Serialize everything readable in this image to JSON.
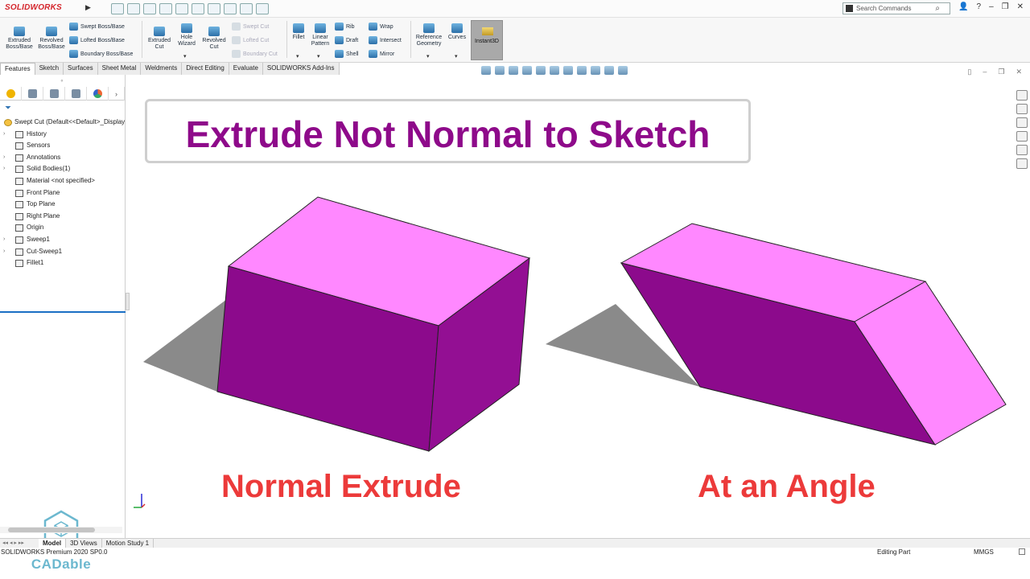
{
  "app": {
    "logo_text": "SOLIDWORKS"
  },
  "search": {
    "placeholder": "Search Commands"
  },
  "ribbon": {
    "extruded_boss": "Extruded Boss/Base",
    "revolved_boss": "Revolved Boss/Base",
    "swept_boss": "Swept Boss/Base",
    "lofted_boss": "Lofted Boss/Base",
    "boundary_boss": "Boundary Boss/Base",
    "extruded_cut": "Extruded Cut",
    "hole_wizard": "Hole Wizard",
    "revolved_cut": "Revolved Cut",
    "swept_cut": "Swept Cut",
    "lofted_cut": "Lofted Cut",
    "boundary_cut": "Boundary Cut",
    "fillet": "Fillet",
    "linear_pattern": "Linear Pattern",
    "rib": "Rib",
    "draft": "Draft",
    "shell": "Shell",
    "wrap": "Wrap",
    "intersect": "Intersect",
    "mirror": "Mirror",
    "reference_geometry": "Reference Geometry",
    "curves": "Curves",
    "instant3d": "Instant3D"
  },
  "command_tabs": [
    "Features",
    "Sketch",
    "Surfaces",
    "Sheet Metal",
    "Weldments",
    "Direct Editing",
    "Evaluate",
    "SOLIDWORKS Add-Ins"
  ],
  "tree": {
    "root": "Swept Cut  (Default<<Default>_Display",
    "items": [
      "History",
      "Sensors",
      "Annotations",
      "Solid Bodies(1)",
      "Material <not specified>",
      "Front Plane",
      "Top Plane",
      "Right Plane",
      "Origin",
      "Sweep1",
      "Cut-Sweep1",
      "Fillet1"
    ]
  },
  "overlay": {
    "title": "Extrude Not Normal to Sketch",
    "left_caption": "Normal Extrude",
    "right_caption": "At an Angle",
    "brand": "CADable"
  },
  "colors": {
    "title": "#8e0a8a",
    "caption": "#ec3a3a",
    "top_face": "#ff88ff",
    "front_face": "#8c0a8c",
    "accent": "#1a6fc4"
  },
  "bottom_tabs": [
    "Model",
    "3D Views",
    "Motion Study 1"
  ],
  "status": {
    "app_version": "SOLIDWORKS Premium 2020 SP0.0",
    "mode": "Editing Part",
    "units": "MMGS"
  }
}
